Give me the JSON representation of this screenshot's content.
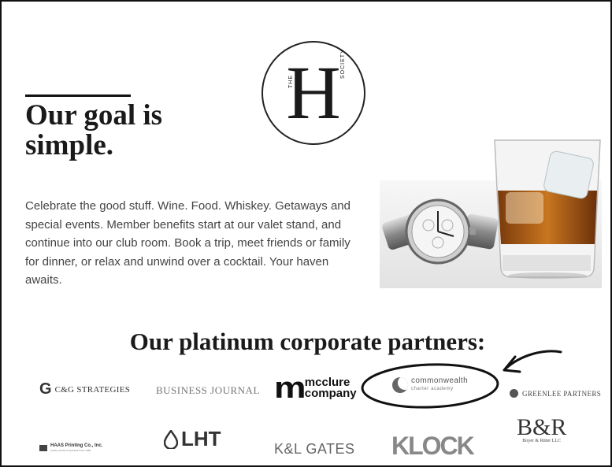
{
  "logo": {
    "the": "THE",
    "letter": "H",
    "society": "SOCIETY"
  },
  "intro": {
    "heading": "Our goal is simple.",
    "body": "Celebrate the good stuff. Wine. Food. Whiskey. Getaways and special events. Member benefits start at our valet stand, and continue into our club room. Book a trip, meet friends or family for dinner, or relax and unwind over a cocktail. Your haven awaits."
  },
  "partners": {
    "title": "Our platinum corporate partners:",
    "cg": {
      "mark": "G",
      "name": "C&G STRATEGIES"
    },
    "business_journal": "BUSINESS JOURNAL",
    "mcclure": {
      "mark": "m",
      "line1": "mcclure",
      "line2": "company"
    },
    "commonwealth": {
      "line1": "commonwealth",
      "line2": "charter academy"
    },
    "greenlee": "GREENLEE PARTNERS",
    "haas": {
      "line1": "HAAS Printing Co., Inc.",
      "line2": "Family Owned & Operated Since 1956"
    },
    "lht": "LHT",
    "klgates": "K&L GATES",
    "klock": "KLOCK",
    "boyer": {
      "mark": "B&R",
      "name": "Boyer & Ritter LLC"
    }
  },
  "colors": {
    "ink": "#1a1a1a",
    "whiskey": "#b5651d",
    "annotation": "#111111"
  }
}
